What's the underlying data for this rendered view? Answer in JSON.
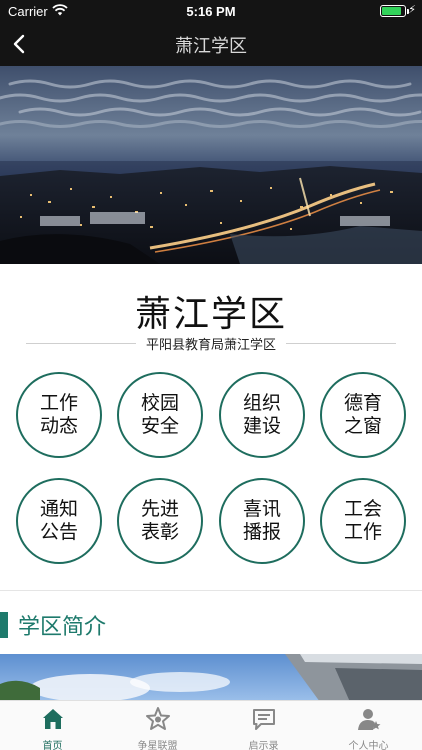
{
  "status_bar": {
    "carrier": "Carrier",
    "time": "5:16 PM",
    "battery_level": 0.85
  },
  "nav": {
    "title": "萧江学区",
    "back_icon": "chevron-left-icon"
  },
  "header": {
    "title": "萧江学区",
    "subtitle": "平阳县教育局萧江学区"
  },
  "menu": [
    {
      "label": "工作动态"
    },
    {
      "label": "校园安全"
    },
    {
      "label": "组织建设"
    },
    {
      "label": "德育之窗"
    },
    {
      "label": "通知公告"
    },
    {
      "label": "先进表彰"
    },
    {
      "label": "喜讯播报"
    },
    {
      "label": "工会工作"
    }
  ],
  "section": {
    "title": "学区简介"
  },
  "tabs": [
    {
      "label": "首页",
      "icon": "home-icon",
      "active": true
    },
    {
      "label": "争星联盟",
      "icon": "star-icon",
      "active": false
    },
    {
      "label": "启示录",
      "icon": "message-icon",
      "active": false
    },
    {
      "label": "个人中心",
      "icon": "user-icon",
      "active": false
    }
  ],
  "colors": {
    "accent": "#1e6d5e",
    "bar_bg": "#141414",
    "battery": "#32d35a"
  }
}
